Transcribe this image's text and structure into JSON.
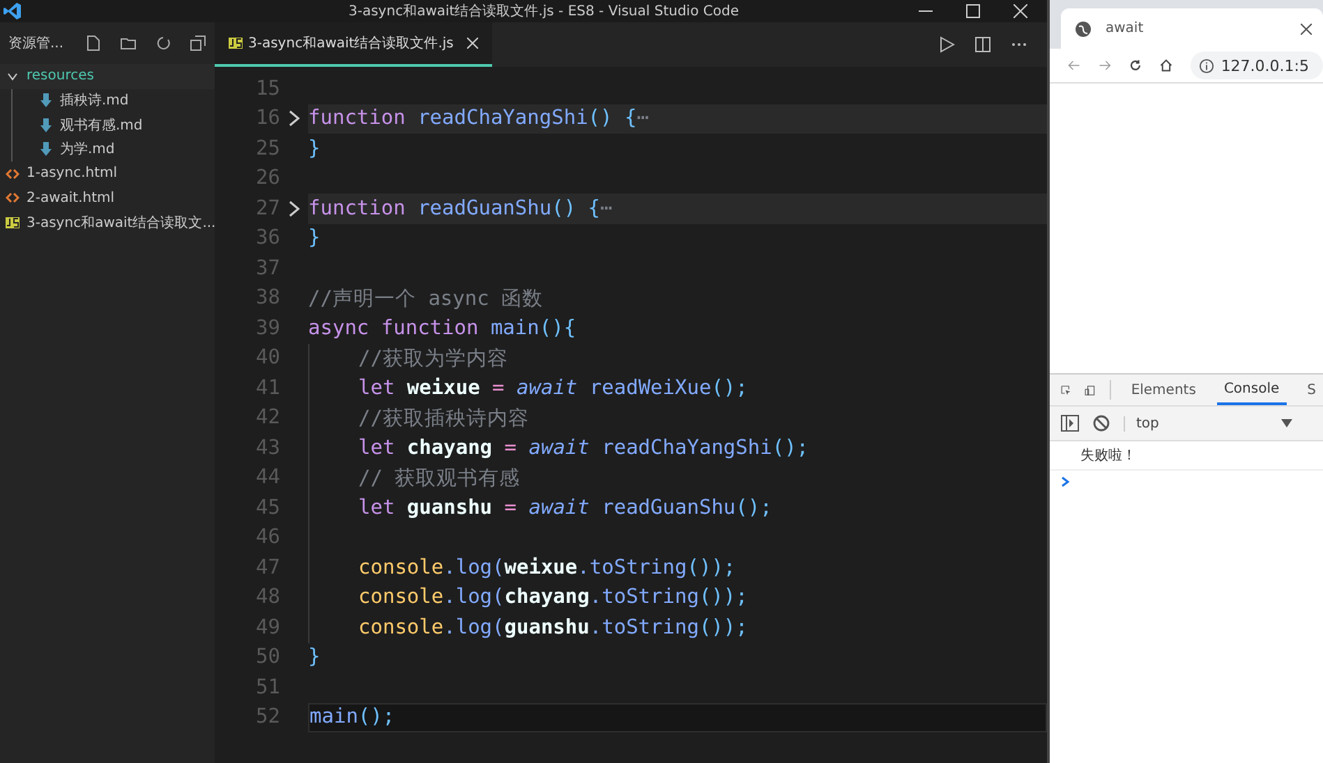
{
  "title_bar": {
    "title": "3-async和await结合读取文件.js - ES8 - Visual Studio Code"
  },
  "explorer": {
    "title": "资源管...",
    "tree": [
      {
        "label": "resources",
        "kind": "folder",
        "expanded": true,
        "children": [
          {
            "label": "插秧诗.md",
            "kind": "md"
          },
          {
            "label": "观书有感.md",
            "kind": "md"
          },
          {
            "label": "为学.md",
            "kind": "md"
          }
        ]
      },
      {
        "label": "1-async.html",
        "kind": "html"
      },
      {
        "label": "2-await.html",
        "kind": "html"
      },
      {
        "label": "3-async和await结合读取文...",
        "kind": "js"
      }
    ]
  },
  "editor": {
    "tabs": [
      {
        "label": "3-async和await结合读取文件.js",
        "selected": true
      }
    ],
    "lines": [
      {
        "number": "15"
      },
      {
        "number": "16",
        "folded": true,
        "tokens": [
          {
            "text": "function ",
            "kind": "keyword"
          },
          {
            "text": "readChaYangShi",
            "kind": "function"
          },
          {
            "text": "() {",
            "kind": "punct"
          },
          {
            "text": "⋯",
            "kind": "comment"
          }
        ]
      },
      {
        "number": "25",
        "tokens": [
          {
            "text": "}",
            "kind": "punct"
          }
        ]
      },
      {
        "number": "26"
      },
      {
        "number": "27",
        "folded": true,
        "tokens": [
          {
            "text": "function ",
            "kind": "keyword"
          },
          {
            "text": "readGuanShu",
            "kind": "function"
          },
          {
            "text": "() {",
            "kind": "punct"
          },
          {
            "text": "⋯",
            "kind": "comment"
          }
        ]
      },
      {
        "number": "36",
        "tokens": [
          {
            "text": "}",
            "kind": "punct"
          }
        ]
      },
      {
        "number": "37"
      },
      {
        "number": "38",
        "tokens": [
          {
            "text": "//声明一个 async 函数",
            "kind": "comment"
          }
        ]
      },
      {
        "number": "39",
        "tokens": [
          {
            "text": "async function ",
            "kind": "keyword"
          },
          {
            "text": "main",
            "kind": "function"
          },
          {
            "text": "(){",
            "kind": "punct"
          }
        ]
      },
      {
        "number": "40",
        "indented": true,
        "tokens": [
          {
            "text": "//获取为学内容",
            "kind": "comment"
          }
        ]
      },
      {
        "number": "41",
        "indented": true,
        "tokens": [
          {
            "text": "let ",
            "kind": "keyword"
          },
          {
            "text": "weixue",
            "kind": "variable"
          },
          {
            "text": " = ",
            "kind": "operator"
          },
          {
            "text": "await",
            "kind": "await"
          },
          {
            "text": " readWeiXue",
            "kind": "function"
          },
          {
            "text": "();",
            "kind": "punct"
          }
        ]
      },
      {
        "number": "42",
        "indented": true,
        "tokens": [
          {
            "text": "//获取插秧诗内容",
            "kind": "comment"
          }
        ]
      },
      {
        "number": "43",
        "indented": true,
        "tokens": [
          {
            "text": "let ",
            "kind": "keyword"
          },
          {
            "text": "chayang",
            "kind": "variable"
          },
          {
            "text": " = ",
            "kind": "operator"
          },
          {
            "text": "await",
            "kind": "await"
          },
          {
            "text": " readChaYangShi",
            "kind": "function"
          },
          {
            "text": "();",
            "kind": "punct"
          }
        ]
      },
      {
        "number": "44",
        "indented": true,
        "tokens": [
          {
            "text": "// 获取观书有感",
            "kind": "comment"
          }
        ]
      },
      {
        "number": "45",
        "indented": true,
        "tokens": [
          {
            "text": "let ",
            "kind": "keyword"
          },
          {
            "text": "guanshu",
            "kind": "variable"
          },
          {
            "text": " = ",
            "kind": "operator"
          },
          {
            "text": "await",
            "kind": "await"
          },
          {
            "text": " readGuanShu",
            "kind": "function"
          },
          {
            "text": "();",
            "kind": "punct"
          }
        ]
      },
      {
        "number": "46",
        "indented": true
      },
      {
        "number": "47",
        "indented": true,
        "tokens": [
          {
            "text": "console",
            "kind": "object"
          },
          {
            "text": ".log(",
            "kind": "function"
          },
          {
            "text": "weixue",
            "kind": "variable"
          },
          {
            "text": ".toString",
            "kind": "function"
          },
          {
            "text": "());",
            "kind": "punct"
          }
        ]
      },
      {
        "number": "48",
        "indented": true,
        "tokens": [
          {
            "text": "console",
            "kind": "object"
          },
          {
            "text": ".log(",
            "kind": "function"
          },
          {
            "text": "chayang",
            "kind": "variable"
          },
          {
            "text": ".toString",
            "kind": "function"
          },
          {
            "text": "());",
            "kind": "punct"
          }
        ]
      },
      {
        "number": "49",
        "indented": true,
        "tokens": [
          {
            "text": "console",
            "kind": "object"
          },
          {
            "text": ".log(",
            "kind": "function"
          },
          {
            "text": "guanshu",
            "kind": "variable"
          },
          {
            "text": ".toString",
            "kind": "function"
          },
          {
            "text": "());",
            "kind": "punct"
          }
        ]
      },
      {
        "number": "50",
        "tokens": [
          {
            "text": "}",
            "kind": "punct"
          }
        ]
      },
      {
        "number": "51"
      },
      {
        "number": "52",
        "current": true,
        "tokens": [
          {
            "text": "main",
            "kind": "function"
          },
          {
            "text": "();",
            "kind": "punct"
          }
        ]
      }
    ]
  },
  "browser": {
    "tab_title": "await",
    "address": "127.0.0.1:5",
    "devtools": {
      "tabs": [
        {
          "label": "Elements",
          "selected": false
        },
        {
          "label": "Console",
          "selected": true
        },
        {
          "label": "S",
          "selected": false
        }
      ],
      "context": "top",
      "messages": [
        "失败啦！"
      ]
    }
  }
}
